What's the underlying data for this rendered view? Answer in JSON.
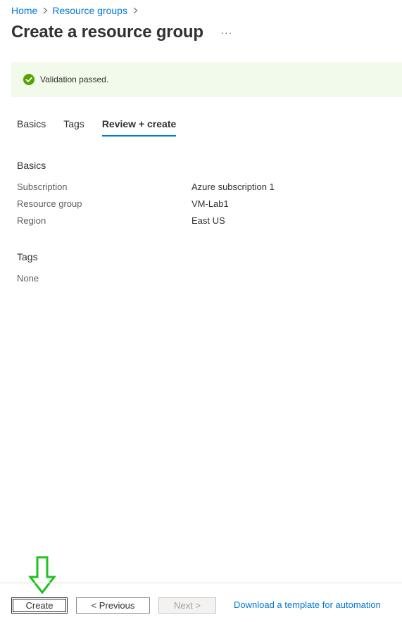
{
  "breadcrumb": {
    "items": [
      {
        "label": "Home"
      },
      {
        "label": "Resource groups"
      }
    ]
  },
  "page": {
    "title": "Create a resource group",
    "more_label": "···"
  },
  "banner": {
    "icon": "check-circle-icon",
    "status_color": "#57a300",
    "background": "#f1faeb",
    "text": "Validation passed."
  },
  "tabs": [
    {
      "label": "Basics",
      "active": false
    },
    {
      "label": "Tags",
      "active": false
    },
    {
      "label": "Review + create",
      "active": true
    }
  ],
  "review": {
    "basics_heading": "Basics",
    "rows": [
      {
        "label": "Subscription",
        "value": "Azure subscription 1"
      },
      {
        "label": "Resource group",
        "value": "VM-Lab1"
      },
      {
        "label": "Region",
        "value": "East US"
      }
    ],
    "tags_heading": "Tags",
    "tags_value": "None"
  },
  "footer": {
    "create_label": "Create",
    "previous_label": "< Previous",
    "next_label": "Next >",
    "download_label": "Download a template for automation"
  },
  "colors": {
    "accent": "#0078d4",
    "annotation": "#1ec31e"
  }
}
